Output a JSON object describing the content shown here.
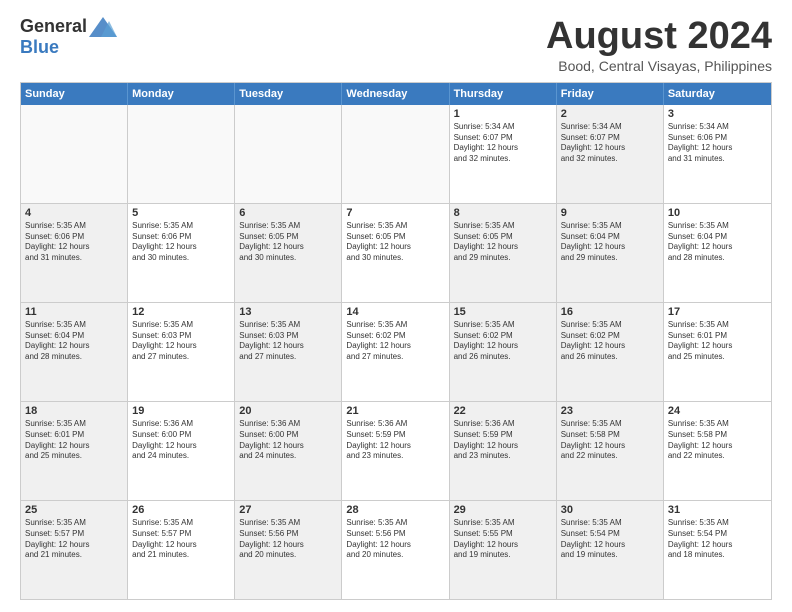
{
  "logo": {
    "general": "General",
    "blue": "Blue"
  },
  "title": "August 2024",
  "location": "Bood, Central Visayas, Philippines",
  "days": [
    "Sunday",
    "Monday",
    "Tuesday",
    "Wednesday",
    "Thursday",
    "Friday",
    "Saturday"
  ],
  "rows": [
    [
      {
        "day": "",
        "empty": true
      },
      {
        "day": "",
        "empty": true
      },
      {
        "day": "",
        "empty": true
      },
      {
        "day": "",
        "empty": true
      },
      {
        "day": "1",
        "lines": [
          "Sunrise: 5:34 AM",
          "Sunset: 6:07 PM",
          "Daylight: 12 hours",
          "and 32 minutes."
        ]
      },
      {
        "day": "2",
        "lines": [
          "Sunrise: 5:34 AM",
          "Sunset: 6:07 PM",
          "Daylight: 12 hours",
          "and 32 minutes."
        ],
        "shaded": true
      },
      {
        "day": "3",
        "lines": [
          "Sunrise: 5:34 AM",
          "Sunset: 6:06 PM",
          "Daylight: 12 hours",
          "and 31 minutes."
        ]
      }
    ],
    [
      {
        "day": "4",
        "lines": [
          "Sunrise: 5:35 AM",
          "Sunset: 6:06 PM",
          "Daylight: 12 hours",
          "and 31 minutes."
        ],
        "shaded": true
      },
      {
        "day": "5",
        "lines": [
          "Sunrise: 5:35 AM",
          "Sunset: 6:06 PM",
          "Daylight: 12 hours",
          "and 30 minutes."
        ]
      },
      {
        "day": "6",
        "lines": [
          "Sunrise: 5:35 AM",
          "Sunset: 6:05 PM",
          "Daylight: 12 hours",
          "and 30 minutes."
        ],
        "shaded": true
      },
      {
        "day": "7",
        "lines": [
          "Sunrise: 5:35 AM",
          "Sunset: 6:05 PM",
          "Daylight: 12 hours",
          "and 30 minutes."
        ]
      },
      {
        "day": "8",
        "lines": [
          "Sunrise: 5:35 AM",
          "Sunset: 6:05 PM",
          "Daylight: 12 hours",
          "and 29 minutes."
        ],
        "shaded": true
      },
      {
        "day": "9",
        "lines": [
          "Sunrise: 5:35 AM",
          "Sunset: 6:04 PM",
          "Daylight: 12 hours",
          "and 29 minutes."
        ],
        "shaded": true
      },
      {
        "day": "10",
        "lines": [
          "Sunrise: 5:35 AM",
          "Sunset: 6:04 PM",
          "Daylight: 12 hours",
          "and 28 minutes."
        ]
      }
    ],
    [
      {
        "day": "11",
        "lines": [
          "Sunrise: 5:35 AM",
          "Sunset: 6:04 PM",
          "Daylight: 12 hours",
          "and 28 minutes."
        ],
        "shaded": true
      },
      {
        "day": "12",
        "lines": [
          "Sunrise: 5:35 AM",
          "Sunset: 6:03 PM",
          "Daylight: 12 hours",
          "and 27 minutes."
        ]
      },
      {
        "day": "13",
        "lines": [
          "Sunrise: 5:35 AM",
          "Sunset: 6:03 PM",
          "Daylight: 12 hours",
          "and 27 minutes."
        ],
        "shaded": true
      },
      {
        "day": "14",
        "lines": [
          "Sunrise: 5:35 AM",
          "Sunset: 6:02 PM",
          "Daylight: 12 hours",
          "and 27 minutes."
        ]
      },
      {
        "day": "15",
        "lines": [
          "Sunrise: 5:35 AM",
          "Sunset: 6:02 PM",
          "Daylight: 12 hours",
          "and 26 minutes."
        ],
        "shaded": true
      },
      {
        "day": "16",
        "lines": [
          "Sunrise: 5:35 AM",
          "Sunset: 6:02 PM",
          "Daylight: 12 hours",
          "and 26 minutes."
        ],
        "shaded": true
      },
      {
        "day": "17",
        "lines": [
          "Sunrise: 5:35 AM",
          "Sunset: 6:01 PM",
          "Daylight: 12 hours",
          "and 25 minutes."
        ]
      }
    ],
    [
      {
        "day": "18",
        "lines": [
          "Sunrise: 5:35 AM",
          "Sunset: 6:01 PM",
          "Daylight: 12 hours",
          "and 25 minutes."
        ],
        "shaded": true
      },
      {
        "day": "19",
        "lines": [
          "Sunrise: 5:36 AM",
          "Sunset: 6:00 PM",
          "Daylight: 12 hours",
          "and 24 minutes."
        ]
      },
      {
        "day": "20",
        "lines": [
          "Sunrise: 5:36 AM",
          "Sunset: 6:00 PM",
          "Daylight: 12 hours",
          "and 24 minutes."
        ],
        "shaded": true
      },
      {
        "day": "21",
        "lines": [
          "Sunrise: 5:36 AM",
          "Sunset: 5:59 PM",
          "Daylight: 12 hours",
          "and 23 minutes."
        ]
      },
      {
        "day": "22",
        "lines": [
          "Sunrise: 5:36 AM",
          "Sunset: 5:59 PM",
          "Daylight: 12 hours",
          "and 23 minutes."
        ],
        "shaded": true
      },
      {
        "day": "23",
        "lines": [
          "Sunrise: 5:35 AM",
          "Sunset: 5:58 PM",
          "Daylight: 12 hours",
          "and 22 minutes."
        ],
        "shaded": true
      },
      {
        "day": "24",
        "lines": [
          "Sunrise: 5:35 AM",
          "Sunset: 5:58 PM",
          "Daylight: 12 hours",
          "and 22 minutes."
        ]
      }
    ],
    [
      {
        "day": "25",
        "lines": [
          "Sunrise: 5:35 AM",
          "Sunset: 5:57 PM",
          "Daylight: 12 hours",
          "and 21 minutes."
        ],
        "shaded": true
      },
      {
        "day": "26",
        "lines": [
          "Sunrise: 5:35 AM",
          "Sunset: 5:57 PM",
          "Daylight: 12 hours",
          "and 21 minutes."
        ]
      },
      {
        "day": "27",
        "lines": [
          "Sunrise: 5:35 AM",
          "Sunset: 5:56 PM",
          "Daylight: 12 hours",
          "and 20 minutes."
        ],
        "shaded": true
      },
      {
        "day": "28",
        "lines": [
          "Sunrise: 5:35 AM",
          "Sunset: 5:56 PM",
          "Daylight: 12 hours",
          "and 20 minutes."
        ]
      },
      {
        "day": "29",
        "lines": [
          "Sunrise: 5:35 AM",
          "Sunset: 5:55 PM",
          "Daylight: 12 hours",
          "and 19 minutes."
        ],
        "shaded": true
      },
      {
        "day": "30",
        "lines": [
          "Sunrise: 5:35 AM",
          "Sunset: 5:54 PM",
          "Daylight: 12 hours",
          "and 19 minutes."
        ],
        "shaded": true
      },
      {
        "day": "31",
        "lines": [
          "Sunrise: 5:35 AM",
          "Sunset: 5:54 PM",
          "Daylight: 12 hours",
          "and 18 minutes."
        ]
      }
    ]
  ]
}
